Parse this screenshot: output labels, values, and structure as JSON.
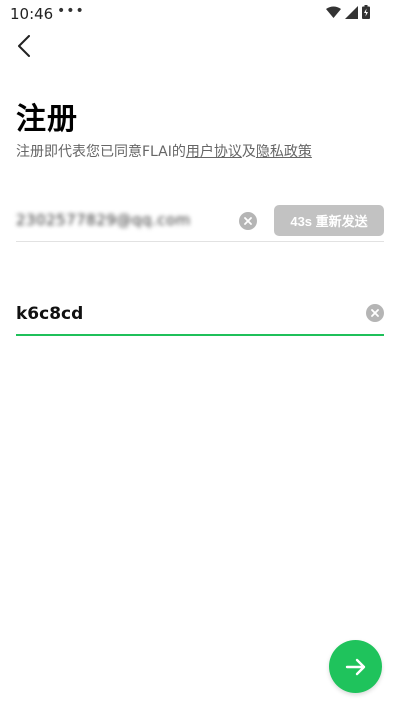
{
  "status_bar": {
    "time": "10:46",
    "dots": "•••"
  },
  "header": {
    "title": "注册"
  },
  "agreement": {
    "prefix": "注册即代表您已同意FLAI的",
    "user_agreement_link": "用户协议",
    "conjunction": "及",
    "privacy_policy_link": "隐私政策"
  },
  "email_field": {
    "value": "2302577829@qq.com",
    "resend_label": "43s 重新发送"
  },
  "code_field": {
    "value": "k6c8cd"
  },
  "colors": {
    "accent_green": "#1fc35c",
    "resend_disabled": "#c2c2c2"
  },
  "icons": {
    "back": "chevron-left-icon",
    "clear": "clear-icon",
    "next": "arrow-right-icon"
  }
}
